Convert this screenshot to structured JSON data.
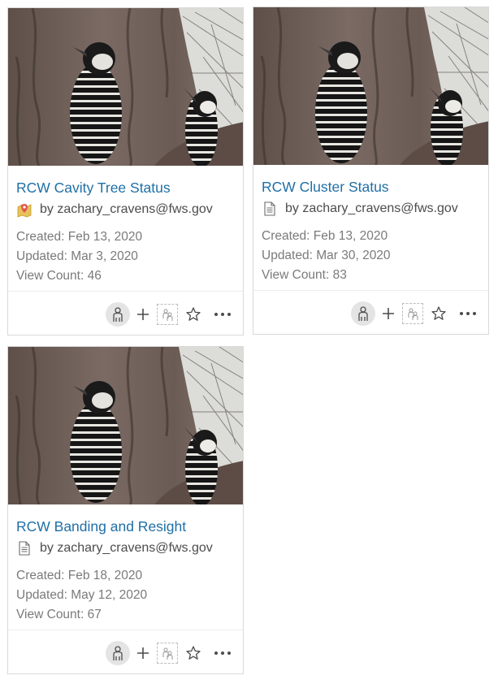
{
  "cards": [
    {
      "title": "RCW Cavity Tree Status",
      "owner": "by zachary_cravens@fws.gov",
      "type_icon": "map-app-icon",
      "created": "Created: Feb 13, 2020",
      "updated": "Updated: Mar 3, 2020",
      "views": "View Count: 46"
    },
    {
      "title": "RCW Cluster Status",
      "owner": "by zachary_cravens@fws.gov",
      "type_icon": "document-icon",
      "created": "Created: Feb 13, 2020",
      "updated": "Updated: Mar 30, 2020",
      "views": "View Count: 83"
    },
    {
      "title": "RCW Banding and Resight",
      "owner": "by zachary_cravens@fws.gov",
      "type_icon": "document-icon",
      "created": "Created: Feb 18, 2020",
      "updated": "Updated: May 12, 2020",
      "views": "View Count: 67"
    }
  ],
  "actions": {
    "owner_icon": "user-icon",
    "add_icon": "plus-icon",
    "share_icon": "group-share-icon",
    "favorite_icon": "star-icon",
    "more_icon": "more-icon"
  },
  "colors": {
    "title_link": "#1f6fa6",
    "meta_text": "#7a7a7a",
    "card_border": "#d9d9d9"
  }
}
